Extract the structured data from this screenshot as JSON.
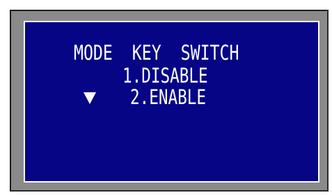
{
  "screen": {
    "title": "MODE  KEY  SWITCH",
    "options": [
      {
        "label": "1.DISABLE"
      },
      {
        "label": "2.ENABLE"
      }
    ],
    "selected_index": 1,
    "cursor_icon": "down-triangle-icon"
  },
  "colors": {
    "lcd_background": "#050586",
    "text": "#ffffff",
    "bezel": "#8a8a8a"
  }
}
